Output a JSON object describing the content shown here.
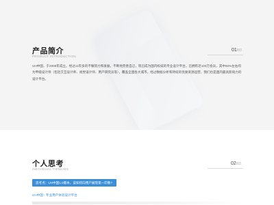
{
  "intro": {
    "title": "产品简介",
    "subtitle": "PRODUCT INTRODUCTION",
    "num": "01",
    "total": "/03",
    "text": "UH中国，于2008年成立。经过11年多的不懈努力和发展，不断地完善自己，现已成为国内权威的专业设计平台。已拥有近100万会员，其中60%左右均为甲级设计师（包括交互设计师、视觉设计师、用户研究员等），覆盖全国各大城市，经过数据分析和持续的优质资源运营，我们也是国内最具影响力的设计平台。"
  },
  "think": {
    "title": "个人思考",
    "subtitle": "INDIVIDUAL THINKING",
    "num": "02",
    "total": "/03",
    "banner": "思考点：UH中国1.0版本，该如何向用户展现第一印象?",
    "link": "UH中国 - 专业用户体验设计平台"
  }
}
